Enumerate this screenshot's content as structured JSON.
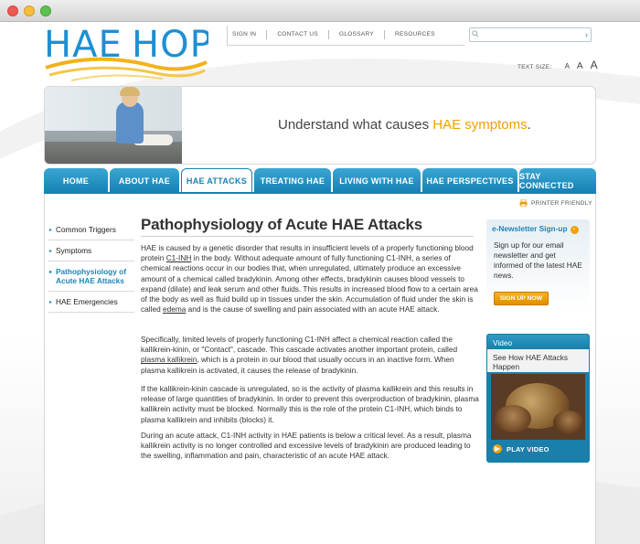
{
  "logo": {
    "text": "HAE HOPE"
  },
  "utility": {
    "links": [
      "SIGN IN",
      "CONTACT US",
      "GLOSSARY",
      "RESOURCES"
    ]
  },
  "search": {
    "placeholder": "",
    "go_icon": "arrow-right-icon"
  },
  "textsize": {
    "label": "TEXT SIZE:",
    "small": "A",
    "medium": "A",
    "large": "A"
  },
  "hero": {
    "tagline_prefix": "Understand what causes ",
    "tagline_highlight": "HAE symptoms",
    "tagline_suffix": "."
  },
  "nav": {
    "items": [
      {
        "label": "HOME"
      },
      {
        "label": "ABOUT HAE"
      },
      {
        "label": "HAE ATTACKS"
      },
      {
        "label": "TREATING HAE"
      },
      {
        "label": "LIVING WITH HAE"
      },
      {
        "label": "HAE PERSPECTIVES"
      },
      {
        "label": "STAY CONNECTED"
      }
    ],
    "active": "HAE ATTACKS"
  },
  "printer": {
    "label": "PRINTER FRIENDLY"
  },
  "subnav": {
    "items": [
      {
        "label": "Common Triggers"
      },
      {
        "label": "Symptoms"
      },
      {
        "label": "Pathophysiology of Acute HAE Attacks"
      },
      {
        "label": "HAE Emergencies"
      }
    ],
    "active": "Pathophysiology of Acute HAE Attacks"
  },
  "article": {
    "title": "Pathophysiology of Acute HAE Attacks",
    "p1": {
      "a": "HAE is caused by a genetic disorder that results in insufficient levels of a properly functioning blood protein ",
      "link": "C1-INH",
      "b": " in the body. Without adequate amount of fully functioning C1-INH, a series of chemical reactions occur in our bodies that, when unregulated, ultimately produce an excessive amount of a chemical called bradykinin.  Among other effects, bradykinin causes blood vessels to expand (dilate) and leak serum and other fluids. This results in increased blood flow to a certain area of the body as well as fluid build up in tissues under the skin. Accumulation of fluid under the skin is called ",
      "link2": "edema",
      "c": " and is the cause of swelling and pain associated with an acute HAE attack."
    },
    "p2": {
      "a": "Specifically, limited levels of properly functioning C1-INH affect a chemical reaction called the kallikrein-kinin, or \"Contact\", cascade. This cascade activates another important protein, called ",
      "link": "plasma kallikrein",
      "b": ", which is a protein in our blood that usually occurs in an inactive form.  When plasma kallikrein is activated, it causes the release of bradykinin."
    },
    "p3": "If the kallikrein-kinin cascade is unregulated, so is the activity of plasma kallikrein and this results in release of large quantities of bradykinin.  In order to prevent this overproduction of bradykinin, plasma kallikrein activity must be blocked. Normally this is the role of the protein C1-INH, which binds to plasma kallikrein and inhibits (blocks) it.",
    "p4": "During an acute attack, C1-INH activity in HAE patients is below a critical level.  As a result, plasma kallikrein activity is no longer controlled and excessive levels of bradykinin are produced leading to the swelling, inflammation and pain, characteristic of an acute HAE attack."
  },
  "newsletter": {
    "title": "e-Newsletter Sign-up",
    "body": "Sign up for our email newsletter and get informed of the latest HAE news.",
    "button": "SIGN UP NOW"
  },
  "video": {
    "header": "Video",
    "description": "See How HAE Attacks Happen",
    "play": "PLAY VIDEO"
  },
  "colors": {
    "brand_blue": "#1581b4",
    "accent_orange": "#f0a000",
    "logo_blue": "#1d8fd3"
  }
}
